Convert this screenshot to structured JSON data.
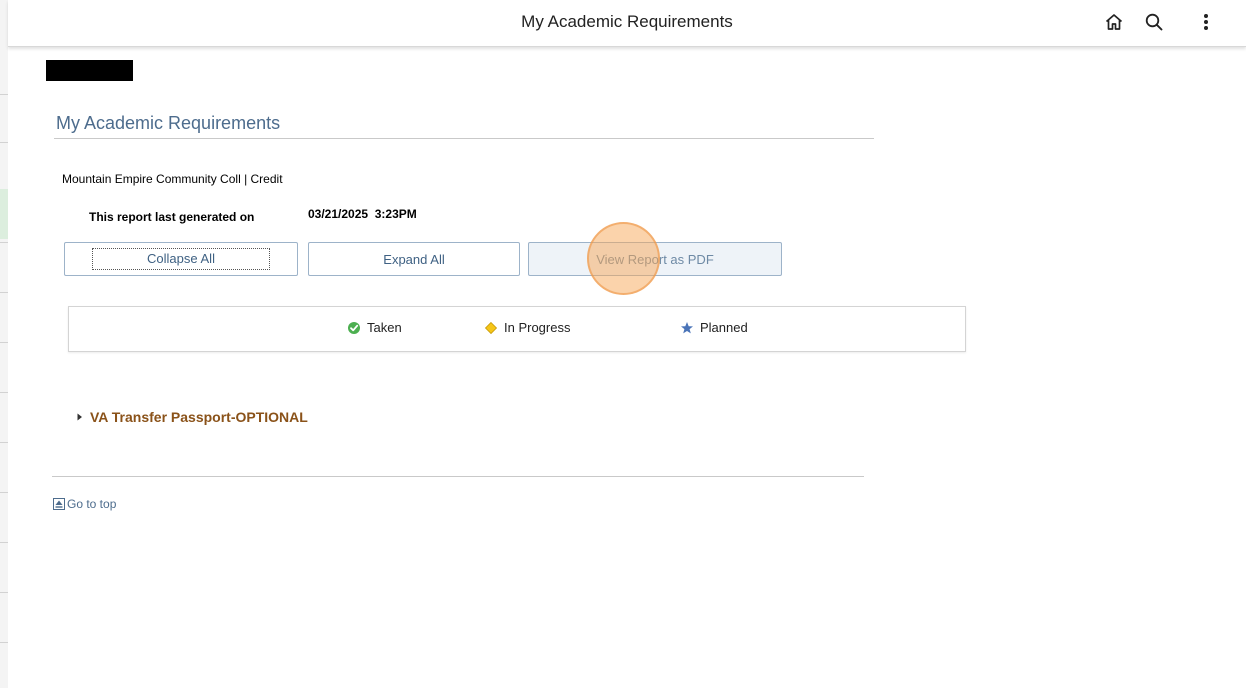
{
  "header": {
    "title": "My Academic Requirements",
    "icons": [
      "home-icon",
      "search-icon",
      "more-vertical-icon"
    ]
  },
  "main": {
    "page_title": "My Academic Requirements",
    "institution": "Mountain Empire Community Coll | Credit",
    "generated_label": "This report last generated on",
    "generated_date": "03/21/2025  3:23PM",
    "buttons": {
      "collapse_all": "Collapse All",
      "expand_all": "Expand All",
      "view_pdf": "View Report as PDF"
    },
    "legend": {
      "taken": "Taken",
      "in_progress": "In Progress",
      "planned": "Planned"
    },
    "colors": {
      "taken": "#4caf50",
      "in_progress": "#f5c518",
      "planned": "#4a74b8",
      "section": "#8a5219",
      "accent": "#4d6c8d"
    },
    "section": {
      "label": "VA Transfer Passport-OPTIONAL"
    },
    "go_to_top": "Go to top"
  }
}
